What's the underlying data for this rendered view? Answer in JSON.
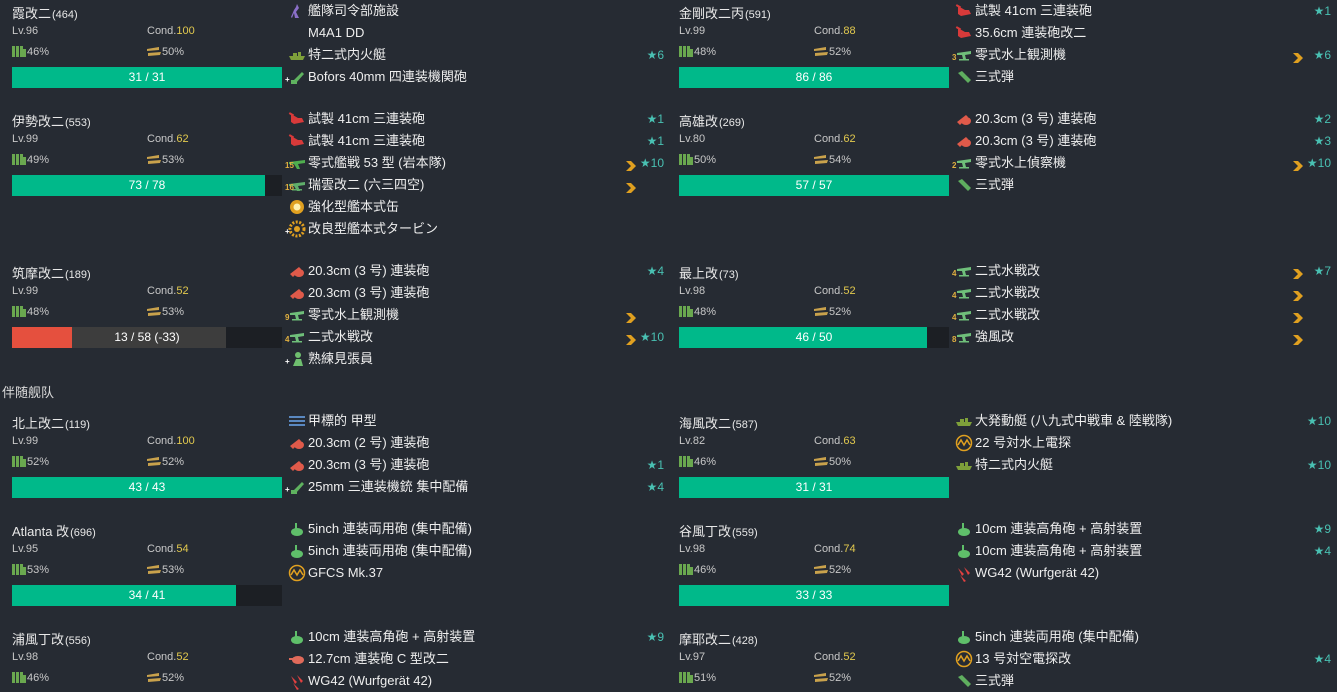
{
  "colors": {
    "hp_green": "#00b98a",
    "hp_red": "#e5503e",
    "cond_yellow": "#e2c94e",
    "star_teal": "#49c0b2",
    "background": "#262b33"
  },
  "section_label": "伴随舰队",
  "lv_prefix": "Lv.",
  "cond_prefix": "Cond.",
  "ships": [
    {
      "id": "kasumi",
      "name": "霞改二",
      "num": "(464)",
      "lv": "96",
      "cond": "100",
      "fuel": "46%",
      "ammo": "50%",
      "hp": "31 / 31",
      "hp_ratio": 1.0,
      "equips": [
        {
          "icon": "facility-icon",
          "label": "艦隊司令部施設"
        },
        {
          "icon": "none",
          "label": "M4A1 DD"
        },
        {
          "icon": "landing-craft-icon",
          "label": "特二式内火艇",
          "star": "★6"
        },
        {
          "icon": "aa-gun-icon",
          "badge": "+",
          "label": "Bofors 40mm 四連装機関砲"
        }
      ]
    },
    {
      "id": "ise",
      "name": "伊勢改二",
      "num": "(553)",
      "lv": "99",
      "cond": "62",
      "fuel": "49%",
      "ammo": "53%",
      "hp": "73 / 78",
      "hp_ratio": 0.936,
      "equips": [
        {
          "icon": "red-gun-icon",
          "label": "試製 41cm 三連装砲",
          "star": "★1"
        },
        {
          "icon": "red-gun-icon",
          "label": "試製 41cm 三連装砲",
          "star": "★1"
        },
        {
          "icon": "fighter-icon",
          "badge": "15",
          "label": "零式艦戦 53 型 (岩本隊)",
          "prof": true,
          "star": "★10"
        },
        {
          "icon": "seaplane-bomber-icon",
          "badge": "16",
          "label": "瑞雲改二 (六三四空)",
          "prof": true
        },
        {
          "icon": "boiler-icon",
          "label": "強化型艦本式缶"
        },
        {
          "icon": "turbine-icon",
          "badge": "+",
          "label": "改良型艦本式タービン"
        }
      ]
    },
    {
      "id": "chikuma",
      "name": "筑摩改二",
      "num": "(189)",
      "lv": "99",
      "cond": "52",
      "fuel": "48%",
      "ammo": "53%",
      "hp": "13 / 58 (-33)",
      "hp_ratio": 0.224,
      "damaged": true,
      "hp_track_ratio": 0.793,
      "equips": [
        {
          "icon": "medium-gun-icon",
          "label": "20.3cm (3 号) 連装砲",
          "star": "★4"
        },
        {
          "icon": "medium-gun-icon",
          "label": "20.3cm (3 号) 連装砲"
        },
        {
          "icon": "seaplane-icon",
          "badge": "9",
          "label": "零式水上観測機",
          "prof": true
        },
        {
          "icon": "seaplane-icon",
          "badge": "4",
          "label": "二式水戦改",
          "prof": true,
          "star": "★10"
        },
        {
          "icon": "lookout-icon",
          "badge": "+",
          "label": "熟練見張員"
        }
      ]
    },
    {
      "id": "kongou",
      "name": "金剛改二丙",
      "num": "(591)",
      "lv": "99",
      "cond": "88",
      "fuel": "48%",
      "ammo": "52%",
      "hp": "86 / 86",
      "hp_ratio": 1.0,
      "equips": [
        {
          "icon": "red-gun-icon",
          "label": "試製 41cm 三連装砲",
          "star": "★1"
        },
        {
          "icon": "red-gun-icon",
          "label": "35.6cm 連装砲改二"
        },
        {
          "icon": "seaplane-icon",
          "badge": "3",
          "label": "零式水上観測機",
          "prof": true,
          "star": "★6"
        },
        {
          "icon": "shell-icon",
          "label": "三式弾"
        }
      ]
    },
    {
      "id": "takao",
      "name": "高雄改",
      "num": "(269)",
      "lv": "80",
      "cond": "62",
      "fuel": "50%",
      "ammo": "54%",
      "hp": "57 / 57",
      "hp_ratio": 1.0,
      "equips": [
        {
          "icon": "medium-gun-icon",
          "label": "20.3cm (3 号) 連装砲",
          "star": "★2"
        },
        {
          "icon": "medium-gun-icon",
          "label": "20.3cm (3 号) 連装砲",
          "star": "★3"
        },
        {
          "icon": "seaplane-icon",
          "badge": "2",
          "label": "零式水上偵察機",
          "prof": true,
          "star": "★10"
        },
        {
          "icon": "shell-icon",
          "label": "三式弾"
        }
      ]
    },
    {
      "id": "mogami",
      "name": "最上改",
      "num": "(73)",
      "lv": "98",
      "cond": "52",
      "fuel": "48%",
      "ammo": "52%",
      "hp": "46 / 50",
      "hp_ratio": 0.92,
      "equips": [
        {
          "icon": "seaplane-icon",
          "badge": "4",
          "label": "二式水戦改",
          "prof": true,
          "star": "★7"
        },
        {
          "icon": "seaplane-icon",
          "badge": "4",
          "label": "二式水戦改",
          "prof": true
        },
        {
          "icon": "seaplane-icon",
          "badge": "4",
          "label": "二式水戦改",
          "prof": true
        },
        {
          "icon": "seaplane-icon",
          "badge": "8",
          "label": "強風改",
          "prof": true
        }
      ]
    },
    {
      "id": "kitakami",
      "name": "北上改二",
      "num": "(119)",
      "lv": "99",
      "cond": "100",
      "fuel": "52%",
      "ammo": "52%",
      "hp": "43 / 43",
      "hp_ratio": 1.0,
      "equips": [
        {
          "icon": "submarine-icon",
          "label": "甲標的 甲型"
        },
        {
          "icon": "medium-gun-icon",
          "label": "20.3cm (2 号) 連装砲"
        },
        {
          "icon": "medium-gun-icon",
          "label": "20.3cm (3 号) 連装砲",
          "star": "★1"
        },
        {
          "icon": "aa-gun-icon",
          "badge": "+",
          "label": "25mm 三連装機銃 集中配備",
          "star": "★4"
        }
      ]
    },
    {
      "id": "atlanta",
      "name": "Atlanta 改",
      "num": "(696)",
      "lv": "95",
      "cond": "54",
      "fuel": "53%",
      "ammo": "53%",
      "hp": "34 / 41",
      "hp_ratio": 0.829,
      "equips": [
        {
          "icon": "hiaa-gun-icon",
          "label": "5inch 連装両用砲 (集中配備)"
        },
        {
          "icon": "hiaa-gun-icon",
          "label": "5inch 連装両用砲 (集中配備)"
        },
        {
          "icon": "radar-icon",
          "label": "GFCS Mk.37"
        }
      ]
    },
    {
      "id": "urakaze",
      "name": "浦風丁改",
      "num": "(556)",
      "lv": "98",
      "cond": "52",
      "fuel": "46%",
      "ammo": "52%",
      "hp": "",
      "hp_ratio": 0,
      "equips": [
        {
          "icon": "hiaa-gun-icon",
          "label": "10cm 連装高角砲 + 高射装置",
          "star": "★9"
        },
        {
          "icon": "small-gun-icon",
          "label": "12.7cm 連装砲 C 型改二"
        },
        {
          "icon": "rocket-icon",
          "label": "WG42 (Wurfgerät 42)"
        }
      ]
    },
    {
      "id": "umikaze",
      "name": "海風改二",
      "num": "(587)",
      "lv": "82",
      "cond": "63",
      "fuel": "46%",
      "ammo": "50%",
      "hp": "31 / 31",
      "hp_ratio": 1.0,
      "equips": [
        {
          "icon": "landing-craft-icon",
          "label": "大発動艇 (八九式中戦車 & 陸戦隊)",
          "star": "★10"
        },
        {
          "icon": "radar-icon",
          "label": "22 号対水上電探"
        },
        {
          "icon": "landing-craft-icon",
          "label": "特二式内火艇",
          "star": "★10"
        }
      ]
    },
    {
      "id": "tanikaze",
      "name": "谷風丁改",
      "num": "(559)",
      "lv": "98",
      "cond": "74",
      "fuel": "46%",
      "ammo": "52%",
      "hp": "33 / 33",
      "hp_ratio": 1.0,
      "equips": [
        {
          "icon": "hiaa-gun-icon",
          "label": "10cm 連装高角砲 + 高射装置",
          "star": "★9"
        },
        {
          "icon": "hiaa-gun-icon",
          "label": "10cm 連装高角砲 + 高射装置",
          "star": "★4"
        },
        {
          "icon": "rocket-icon",
          "label": "WG42 (Wurfgerät 42)"
        }
      ]
    },
    {
      "id": "maya",
      "name": "摩耶改二",
      "num": "(428)",
      "lv": "97",
      "cond": "52",
      "fuel": "51%",
      "ammo": "52%",
      "hp": "",
      "hp_ratio": 0,
      "equips": [
        {
          "icon": "hiaa-gun-icon",
          "label": "5inch 連装両用砲 (集中配備)"
        },
        {
          "icon": "radar-icon",
          "label": "13 号対空電探改",
          "star": "★4"
        },
        {
          "icon": "shell-icon",
          "label": "三式弾"
        }
      ]
    }
  ]
}
